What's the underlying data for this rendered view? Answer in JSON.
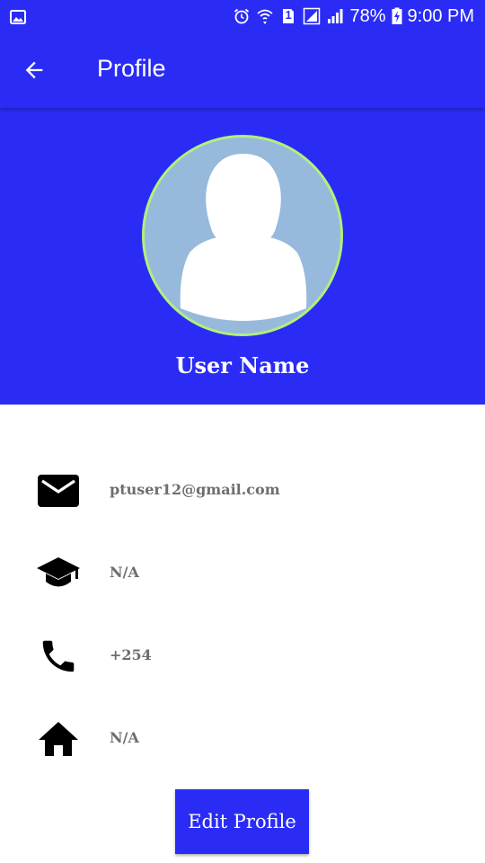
{
  "status_bar": {
    "battery": "78%",
    "time": "9:00 PM",
    "sim_badge": "1",
    "icons": [
      "image-icon",
      "alarm-icon",
      "wifi-icon",
      "sim-icon",
      "signal-icon",
      "battery-icon"
    ]
  },
  "app_bar": {
    "title": "Profile",
    "back_icon": "arrow-back-icon"
  },
  "profile": {
    "user_name": "User Name",
    "avatar_icon": "person-placeholder"
  },
  "info": {
    "email": "ptuser12@gmail.com",
    "education": "N/A",
    "phone": "+254",
    "address": "N/A"
  },
  "actions": {
    "edit_label": "Edit Profile"
  },
  "colors": {
    "primary": "#2a2cf5",
    "avatar_bg": "#96b9dc",
    "avatar_border": "#b2f07a",
    "info_text": "#6e6e6e"
  }
}
